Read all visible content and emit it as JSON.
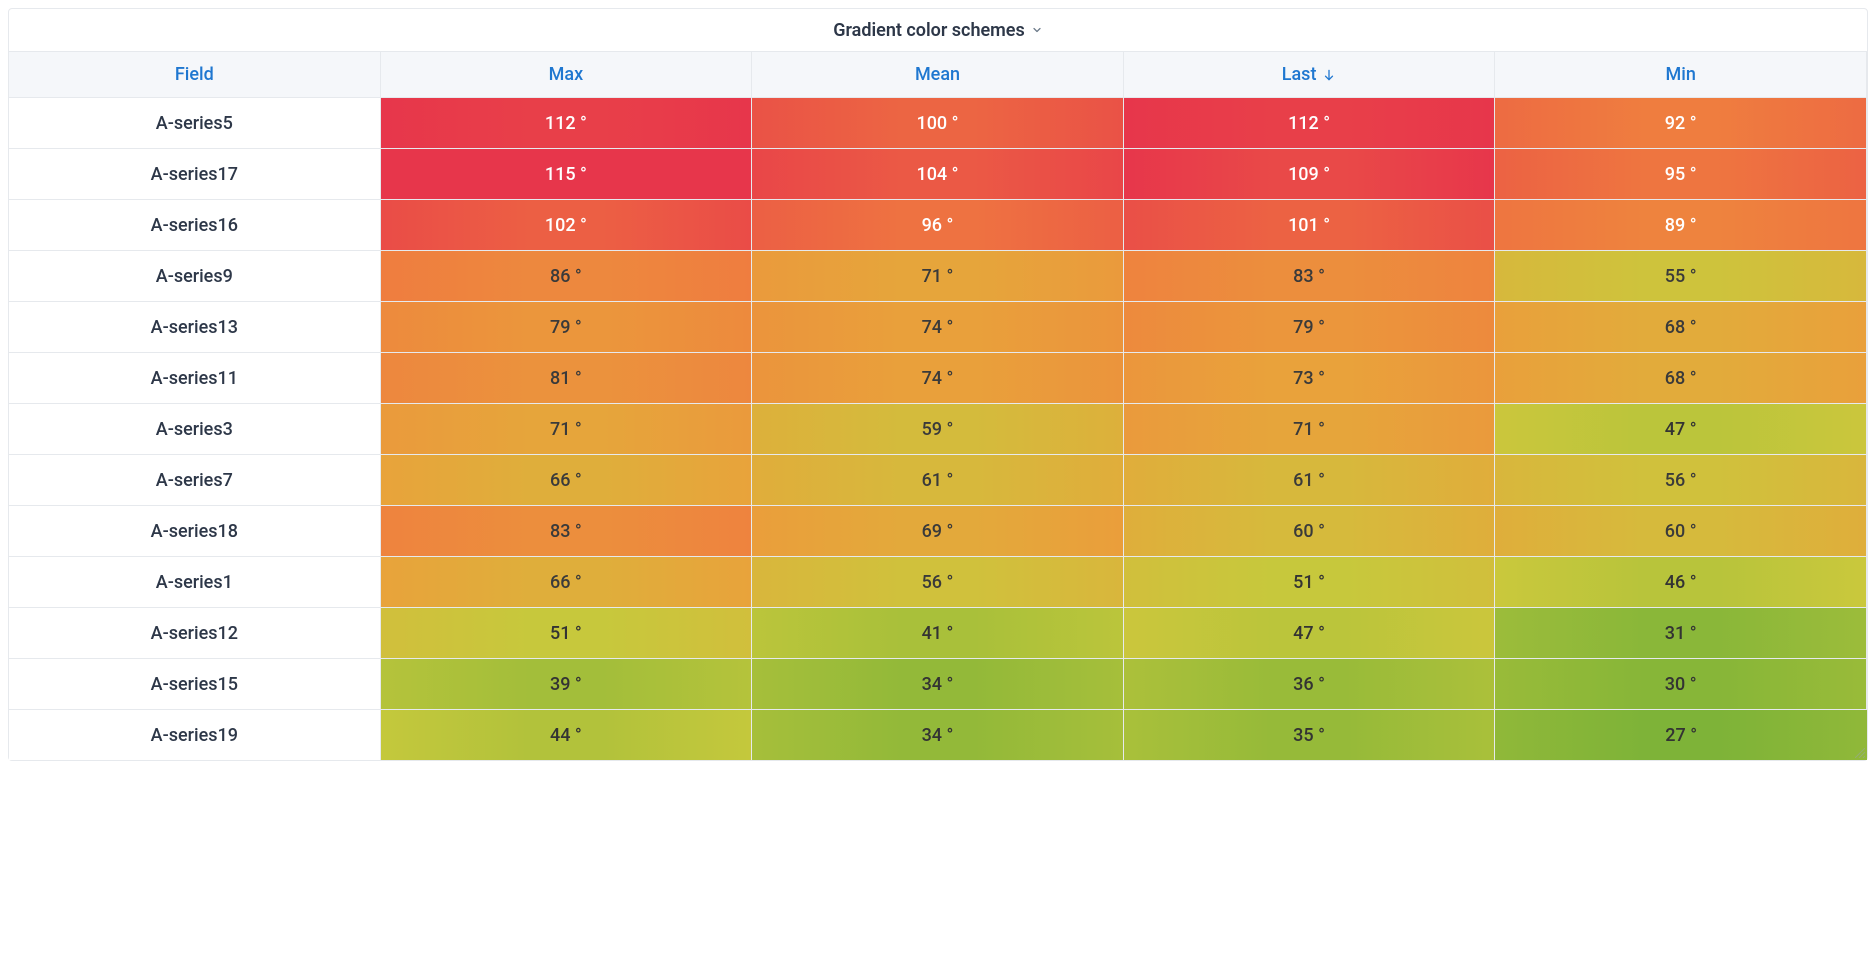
{
  "panel": {
    "title": "Gradient color schemes"
  },
  "columns": [
    {
      "key": "field",
      "label": "Field"
    },
    {
      "key": "max",
      "label": "Max"
    },
    {
      "key": "mean",
      "label": "Mean"
    },
    {
      "key": "last",
      "label": "Last"
    },
    {
      "key": "min",
      "label": "Min"
    }
  ],
  "sort": {
    "column": "last",
    "direction": "desc"
  },
  "unit_suffix": " °",
  "rows": [
    {
      "field": "A-series5",
      "max": 112,
      "mean": 100,
      "last": 112,
      "min": 92
    },
    {
      "field": "A-series17",
      "max": 115,
      "mean": 104,
      "last": 109,
      "min": 95
    },
    {
      "field": "A-series16",
      "max": 102,
      "mean": 96,
      "last": 101,
      "min": 89
    },
    {
      "field": "A-series9",
      "max": 86,
      "mean": 71,
      "last": 83,
      "min": 55
    },
    {
      "field": "A-series13",
      "max": 79,
      "mean": 74,
      "last": 79,
      "min": 68
    },
    {
      "field": "A-series11",
      "max": 81,
      "mean": 74,
      "last": 73,
      "min": 68
    },
    {
      "field": "A-series3",
      "max": 71,
      "mean": 59,
      "last": 71,
      "min": 47
    },
    {
      "field": "A-series7",
      "max": 66,
      "mean": 61,
      "last": 61,
      "min": 56
    },
    {
      "field": "A-series18",
      "max": 83,
      "mean": 69,
      "last": 60,
      "min": 60
    },
    {
      "field": "A-series1",
      "max": 66,
      "mean": 56,
      "last": 51,
      "min": 46
    },
    {
      "field": "A-series12",
      "max": 51,
      "mean": 41,
      "last": 47,
      "min": 31
    },
    {
      "field": "A-series15",
      "max": 39,
      "mean": 34,
      "last": 36,
      "min": 30
    },
    {
      "field": "A-series19",
      "max": 44,
      "mean": 34,
      "last": 35,
      "min": 27
    }
  ],
  "gradient": {
    "min": 27,
    "max": 115,
    "stops": [
      {
        "t": 0.0,
        "c": "#7EB338"
      },
      {
        "t": 0.28,
        "c": "#C9C93C"
      },
      {
        "t": 0.52,
        "c": "#E9A23B"
      },
      {
        "t": 0.75,
        "c": "#EF7B3F"
      },
      {
        "t": 1.0,
        "c": "#E7364B"
      }
    ],
    "white_text_threshold": 88,
    "dark_text_threshold": 55
  },
  "chart_data": {
    "type": "table",
    "title": "Gradient color schemes",
    "columns": [
      "Field",
      "Max",
      "Mean",
      "Last",
      "Min"
    ],
    "sort": {
      "column": "Last",
      "direction": "desc"
    },
    "unit": "°",
    "rows": [
      [
        "A-series5",
        112,
        100,
        112,
        92
      ],
      [
        "A-series17",
        115,
        104,
        109,
        95
      ],
      [
        "A-series16",
        102,
        96,
        101,
        89
      ],
      [
        "A-series9",
        86,
        71,
        83,
        55
      ],
      [
        "A-series13",
        79,
        74,
        79,
        68
      ],
      [
        "A-series11",
        81,
        74,
        73,
        68
      ],
      [
        "A-series3",
        71,
        59,
        71,
        47
      ],
      [
        "A-series7",
        66,
        61,
        61,
        56
      ],
      [
        "A-series18",
        83,
        69,
        60,
        60
      ],
      [
        "A-series1",
        66,
        56,
        51,
        46
      ],
      [
        "A-series12",
        51,
        41,
        47,
        31
      ],
      [
        "A-series15",
        39,
        34,
        36,
        30
      ],
      [
        "A-series19",
        44,
        34,
        35,
        27
      ]
    ],
    "color_scale": {
      "domain": [
        27,
        115
      ],
      "scheme": "green-yellow-orange-red"
    }
  }
}
